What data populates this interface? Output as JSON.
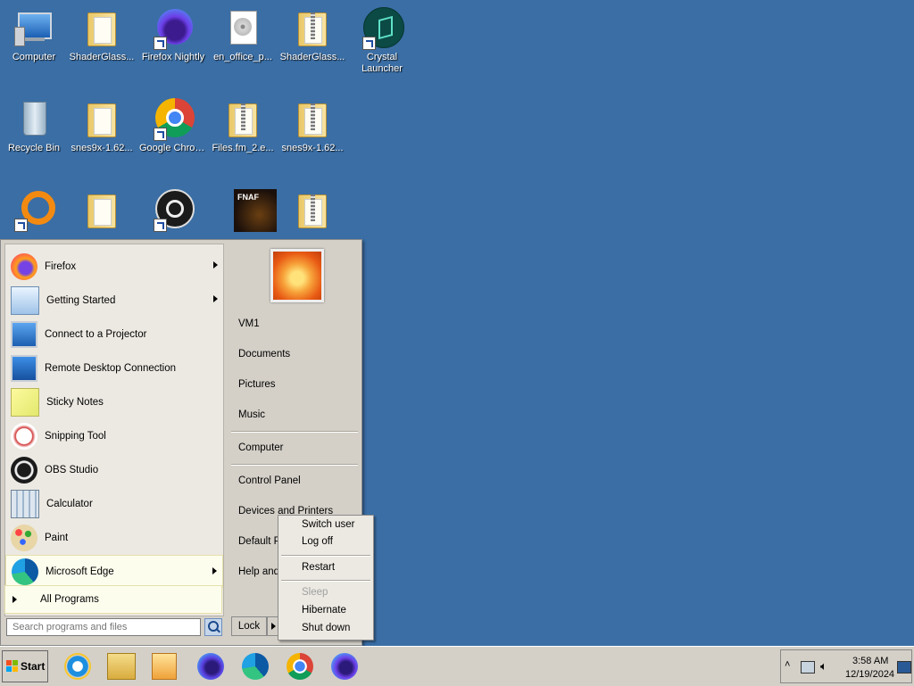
{
  "desktop": {
    "icons": [
      {
        "label": "Computer",
        "icon": "computer-icon"
      },
      {
        "label": "ShaderGlass...",
        "icon": "folder-icon"
      },
      {
        "label": "Firefox Nightly",
        "icon": "firefox-nightly-icon"
      },
      {
        "label": "en_office_p...",
        "icon": "disc-image-icon"
      },
      {
        "label": "ShaderGlass...",
        "icon": "zip-folder-icon"
      },
      {
        "label": "Crystal Launcher",
        "icon": "crystal-launcher-icon"
      },
      {
        "label": "Recycle Bin",
        "icon": "recycle-bin-icon"
      },
      {
        "label": "snes9x-1.62...",
        "icon": "folder-icon"
      },
      {
        "label": "Google Chrome",
        "icon": "chrome-icon"
      },
      {
        "label": "Files.fm_2.e...",
        "icon": "zip-folder-icon"
      },
      {
        "label": "snes9x-1.62...",
        "icon": "zip-folder-icon"
      },
      {
        "label": "",
        "icon": "orange-ring-icon"
      },
      {
        "label": "",
        "icon": "folder-icon"
      },
      {
        "label": "",
        "icon": "obs-icon"
      },
      {
        "label": "FNAF",
        "icon": "game-icon"
      },
      {
        "label": "",
        "icon": "zip-folder-icon"
      }
    ]
  },
  "start_menu": {
    "programs": [
      {
        "label": "Firefox",
        "has_submenu": true
      },
      {
        "label": "Getting Started",
        "has_submenu": true
      },
      {
        "label": "Connect to a Projector",
        "has_submenu": false
      },
      {
        "label": "Remote Desktop Connection",
        "has_submenu": false
      },
      {
        "label": "Sticky Notes",
        "has_submenu": false
      },
      {
        "label": "Snipping Tool",
        "has_submenu": false
      },
      {
        "label": "OBS Studio",
        "has_submenu": false
      },
      {
        "label": "Calculator",
        "has_submenu": false
      },
      {
        "label": "Paint",
        "has_submenu": false
      },
      {
        "label": "Microsoft Edge",
        "has_submenu": true
      }
    ],
    "all_programs": "All Programs",
    "search_placeholder": "Search programs and files",
    "right_links": {
      "user": "VM1",
      "documents": "Documents",
      "pictures": "Pictures",
      "music": "Music",
      "computer": "Computer",
      "control_panel": "Control Panel",
      "devices": "Devices and Printers",
      "default_programs": "Default P",
      "help": "Help and"
    },
    "lock_label": "Lock"
  },
  "power_menu": {
    "switch_user": "Switch user",
    "log_off": "Log off",
    "restart": "Restart",
    "sleep": "Sleep",
    "hibernate": "Hibernate",
    "shut_down": "Shut down"
  },
  "taskbar": {
    "start_label": "Start",
    "pinned": [
      "internet-explorer-icon",
      "file-explorer-icon",
      "media-player-icon",
      "firefox-icon",
      "edge-icon",
      "chrome-icon",
      "firefox-nightly-icon"
    ],
    "clock_time": "3:58 AM",
    "clock_date": "12/19/2024"
  },
  "colors": {
    "desktop": "#3a6ea5",
    "menu_bg": "#d4d0c8",
    "highlight": "#fdfdee"
  }
}
